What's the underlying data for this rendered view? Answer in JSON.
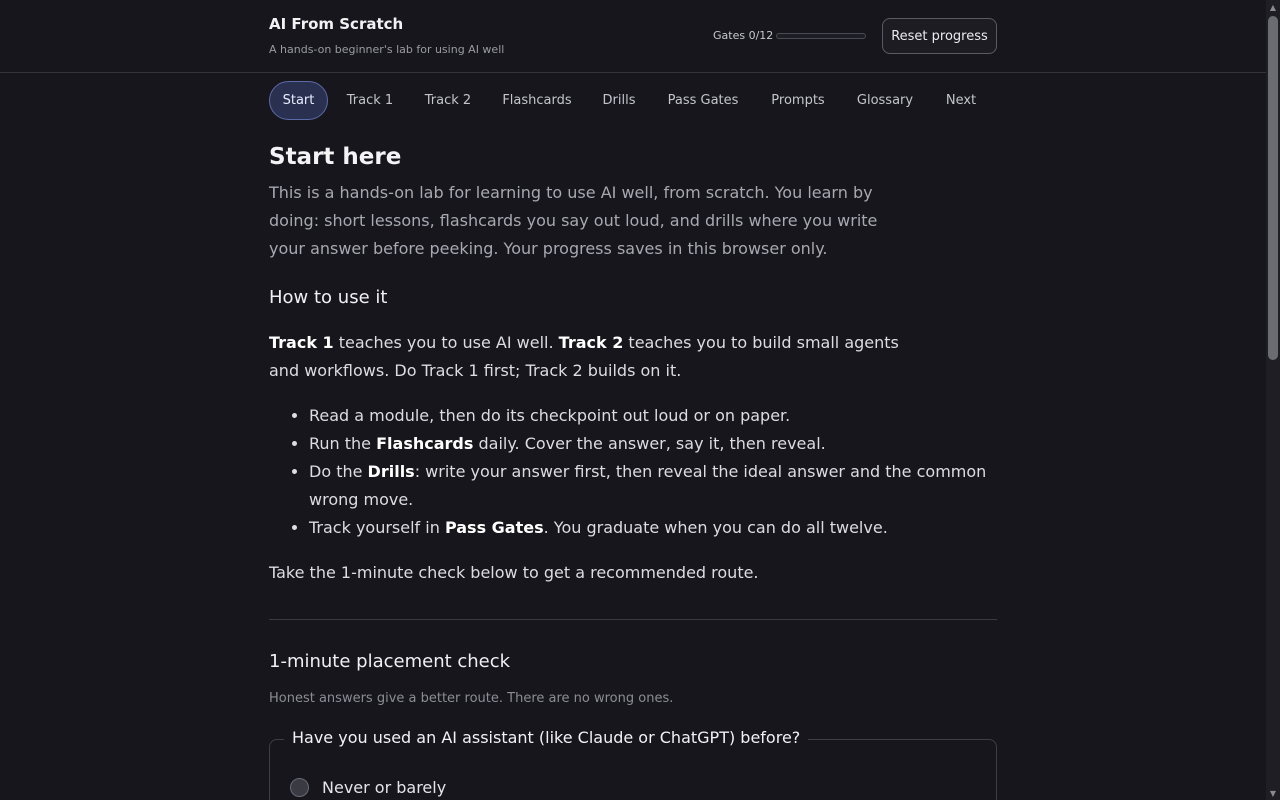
{
  "header": {
    "title": "AI From Scratch",
    "subtitle": "A hands-on beginner's lab for using AI well",
    "gates_label": "Gates 0/12",
    "gates_progress": 0,
    "reset_label": "Reset progress"
  },
  "nav": {
    "tabs": [
      {
        "label": "Start",
        "active": true
      },
      {
        "label": "Track 1"
      },
      {
        "label": "Track 2"
      },
      {
        "label": "Flashcards"
      },
      {
        "label": "Drills"
      },
      {
        "label": "Pass Gates"
      },
      {
        "label": "Prompts"
      },
      {
        "label": "Glossary"
      },
      {
        "label": "Next"
      }
    ]
  },
  "main": {
    "title": "Start here",
    "intro": "This is a hands-on lab for learning to use AI well, from scratch. You learn by doing: short lessons, flashcards you say out loud, and drills where you write your answer before peeking. Your progress saves in this browser only.",
    "howto_heading": "How to use it",
    "tracks_para": {
      "track1": "Track 1",
      "text1": " teaches you to use AI well. ",
      "track2": "Track 2",
      "text2": " teaches you to build small agents and workflows. Do Track 1 first; Track 2 builds on it."
    },
    "steps": [
      {
        "pre": "Read a module, then do its checkpoint out loud or on paper.",
        "bold": "",
        "post": ""
      },
      {
        "pre": "Run the ",
        "bold": "Flashcards",
        "post": " daily. Cover the answer, say it, then reveal."
      },
      {
        "pre": "Do the ",
        "bold": "Drills",
        "post": ": write your answer first, then reveal the ideal answer and the common wrong move."
      },
      {
        "pre": "Track yourself in ",
        "bold": "Pass Gates",
        "post": ". You graduate when you can do all twelve."
      }
    ],
    "cta": "Take the 1-minute check below to get a recommended route."
  },
  "placement": {
    "heading": "1-minute placement check",
    "subtitle": "Honest answers give a better route. There are no wrong ones.",
    "question": "Have you used an AI assistant (like Claude or ChatGPT) before?",
    "options": [
      "Never or barely"
    ]
  },
  "colors": {
    "background": "#16161c",
    "accent": "#5b6aa8",
    "active_tab_bg": "#2a3150"
  }
}
